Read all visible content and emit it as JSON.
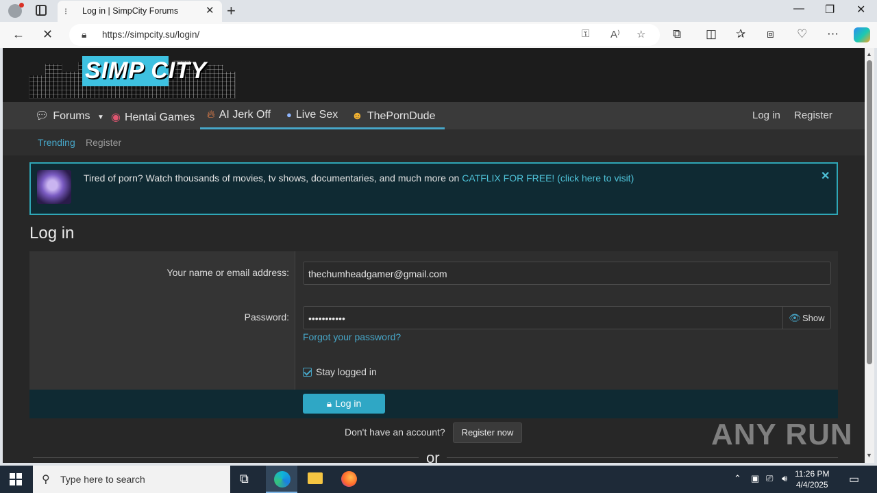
{
  "browser": {
    "tab_title": "Log in | SimpCity Forums",
    "url": "https://simpcity.su/login/"
  },
  "site": {
    "logo_text": "SIMP CITY",
    "nav": {
      "forums": "Forums",
      "hentai_games": "Hentai Games",
      "ai_jerk_off": "AI Jerk Off",
      "live_sex": "Live Sex",
      "the_porn_dude": "ThePornDude",
      "login": "Log in",
      "register": "Register"
    },
    "subnav": {
      "trending": "Trending",
      "register": "Register"
    },
    "notice": {
      "text": "Tired of porn? Watch thousands of movies, tv shows, documentaries, and much more on ",
      "link": "CATFLIX FOR FREE! (click here to visit)"
    },
    "page_title": "Log in",
    "form": {
      "name_label": "Your name or email address:",
      "name_value": "thechumheadgamer@gmail.com",
      "password_label": "Password:",
      "password_value": "•••••••••••",
      "show_label": "Show",
      "forgot_label": "Forgot your password?",
      "stay_label": "Stay logged in",
      "stay_checked": true,
      "login_button": "Log in"
    },
    "no_account": "Don't have an account?",
    "register_now": "Register now",
    "or": "or"
  },
  "watermark": "ANY RUN",
  "taskbar": {
    "search_placeholder": "Type here to search",
    "time": "11:26 PM",
    "date": "4/4/2025"
  },
  "colors": {
    "accent": "#47a7c9",
    "notice_border": "#2fa7b7",
    "button": "#2fa7c5"
  }
}
